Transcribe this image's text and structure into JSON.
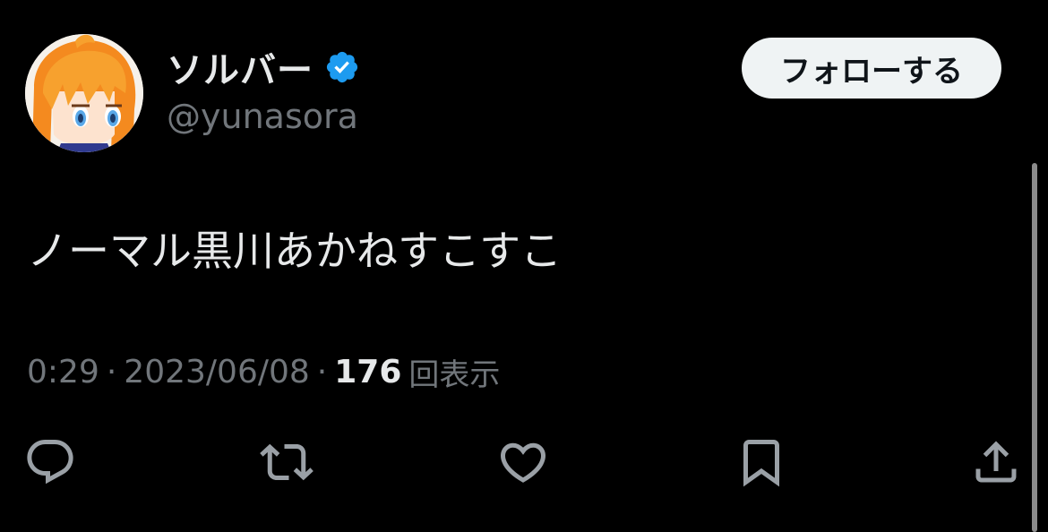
{
  "colors": {
    "background": "#000000",
    "primary_text": "#e7e9ea",
    "secondary_text": "#71767b",
    "verified": "#1d9bf0",
    "follow_button_bg": "#eff3f4",
    "follow_button_text": "#0f1419",
    "icon": "#9aa0a6",
    "scrollbar": "#8b8b8b"
  },
  "user": {
    "display_name": "ソルバー",
    "handle": "@yunasora",
    "verified": true,
    "avatar_icon": "anime-avatar-icon"
  },
  "follow_button": {
    "label": "フォローする"
  },
  "tweet": {
    "text": "ノーマル黒川あかねすこすこ"
  },
  "meta": {
    "time": "0:29",
    "separator": "·",
    "date": "2023/06/08",
    "views": "176",
    "views_label": "回表示"
  },
  "actions": [
    {
      "icon": "reply-icon"
    },
    {
      "icon": "retweet-icon"
    },
    {
      "icon": "like-icon"
    },
    {
      "icon": "bookmark-icon"
    },
    {
      "icon": "share-icon"
    }
  ]
}
